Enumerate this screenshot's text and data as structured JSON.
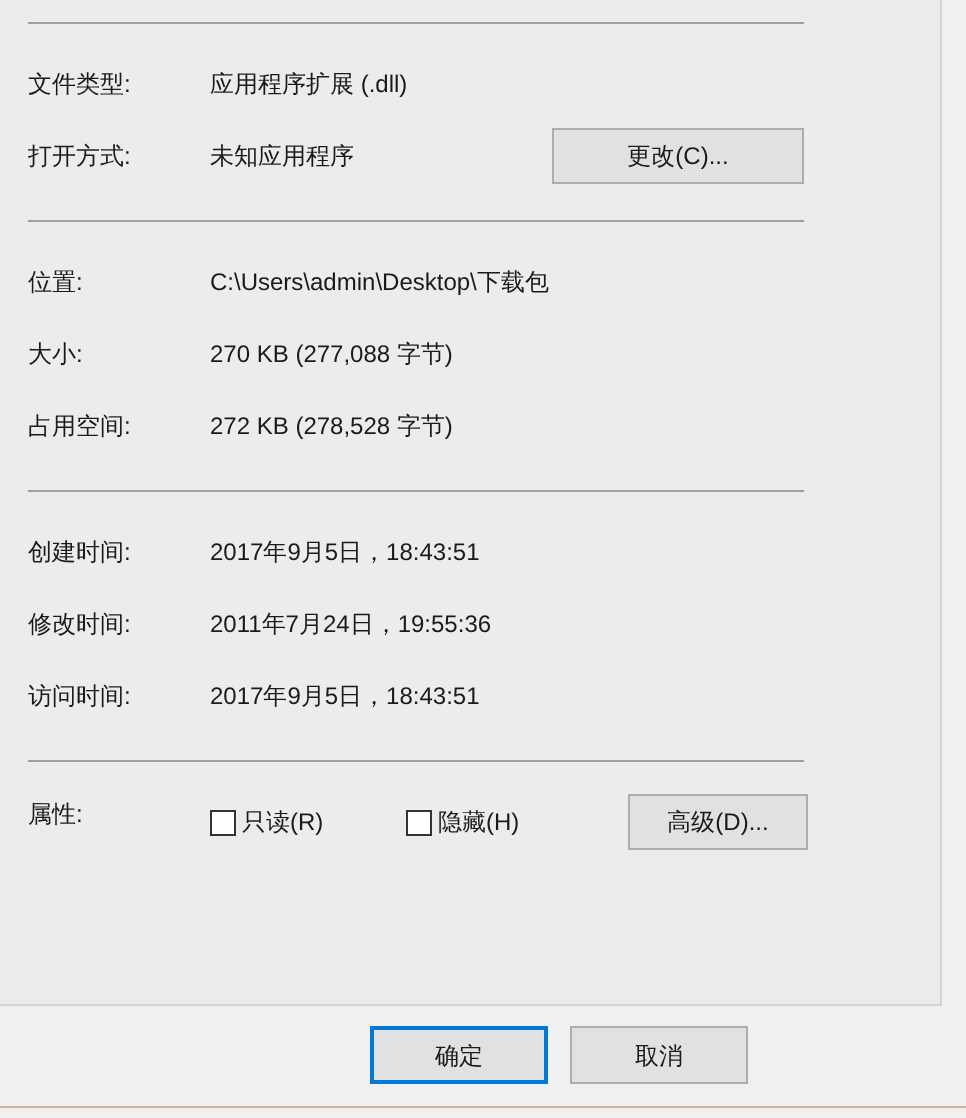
{
  "groups": [
    {
      "rows": [
        {
          "label": "文件类型:",
          "value": "应用程序扩展 (.dll)"
        },
        {
          "label": "打开方式:",
          "value": "未知应用程序",
          "button": "更改(C)..."
        }
      ]
    },
    {
      "rows": [
        {
          "label": "位置:",
          "value": "C:\\Users\\admin\\Desktop\\下载包"
        },
        {
          "label": "大小:",
          "value": "270 KB (277,088 字节)"
        },
        {
          "label": "占用空间:",
          "value": "272 KB (278,528 字节)"
        }
      ]
    },
    {
      "rows": [
        {
          "label": "创建时间:",
          "value": "2017年9月5日，18:43:51"
        },
        {
          "label": "修改时间:",
          "value": "2011年7月24日，19:55:36"
        },
        {
          "label": "访问时间:",
          "value": "2017年9月5日，18:43:51"
        }
      ]
    }
  ],
  "attributes": {
    "label": "属性:",
    "checkboxes": [
      {
        "label": "只读(R)",
        "checked": false
      },
      {
        "label": "隐藏(H)",
        "checked": false
      }
    ],
    "button": "高级(D)..."
  },
  "footer_buttons": [
    {
      "label": "确定",
      "default": true
    },
    {
      "label": "取消",
      "default": false
    }
  ]
}
